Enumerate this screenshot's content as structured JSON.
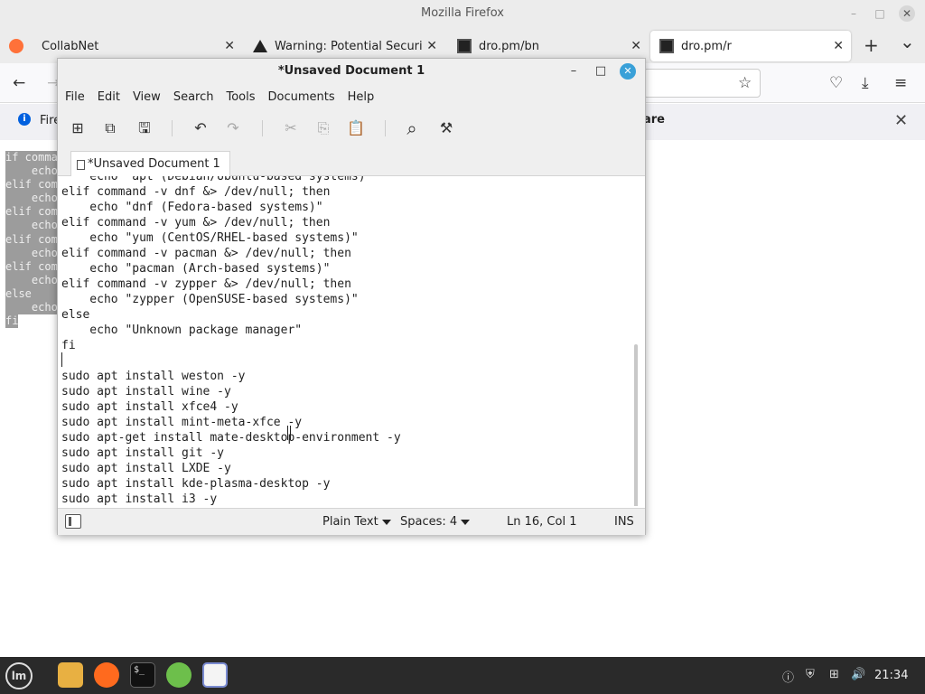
{
  "firefox": {
    "window_title": "Mozilla Firefox",
    "minimize": "–",
    "maximize": "□",
    "close": "✕",
    "tabs": [
      {
        "label": "CollabNet",
        "icon": "none"
      },
      {
        "label": "Warning: Potential Security",
        "icon": "warning-icon"
      },
      {
        "label": "dro.pm/bn",
        "icon": "dro-favicon"
      },
      {
        "label": "dro.pm/r",
        "icon": "dro-favicon",
        "active": true
      }
    ],
    "tab_close": "✕",
    "new_tab": "+",
    "tab_list": "⌄",
    "nav": {
      "back": "←",
      "forward": "→",
      "bookmark": "☆",
      "pocket": "♡",
      "downloads": "⤓",
      "menu": "≡"
    },
    "infobar": {
      "icon": "i",
      "text": "Fire",
      "share": "are",
      "close": "✕"
    },
    "page_code_lines": [
      "if comma",
      "    echo",
      "elif com",
      "    echo",
      "elif com",
      "    echo",
      "elif com",
      "    echo",
      "elif com",
      "    echo",
      "else    ",
      "    echo",
      "fi"
    ]
  },
  "editor": {
    "title": "*Unsaved Document 1",
    "minimize": "–",
    "maximize": "□",
    "close": "✕",
    "menu": [
      "File",
      "Edit",
      "View",
      "Search",
      "Tools",
      "Documents",
      "Help"
    ],
    "toolbar": {
      "new": "⊞",
      "open": "⧉",
      "save": "🖫",
      "undo": "↶",
      "redo": "↷",
      "cut": "✂",
      "copy": "⎘",
      "paste": "📋",
      "find": "⌕",
      "tools": "⚒"
    },
    "tab_label": "*Unsaved Document 1",
    "code_lines": [
      "    echo \"apt (Debian/Ubuntu-based systems)\"",
      "elif command -v dnf &> /dev/null; then",
      "    echo \"dnf (Fedora-based systems)\"",
      "elif command -v yum &> /dev/null; then",
      "    echo \"yum (CentOS/RHEL-based systems)\"",
      "elif command -v pacman &> /dev/null; then",
      "    echo \"pacman (Arch-based systems)\"",
      "elif command -v zypper &> /dev/null; then",
      "    echo \"zypper (OpenSUSE-based systems)\"",
      "else",
      "    echo \"Unknown package manager\"",
      "fi",
      "",
      "sudo apt install weston -y",
      "sudo apt install wine -y",
      "sudo apt install xfce4 -y",
      "sudo apt install mint-meta-xfce -y",
      "sudo apt-get install mate-desktop-environment -y",
      "sudo apt install git -y",
      "sudo apt install LXDE -y",
      "sudo apt install kde-plasma-desktop -y",
      "sudo apt install i3 -y"
    ],
    "status": {
      "syntax": "Plain Text",
      "spaces": "Spaces: 4",
      "position": "Ln 16, Col 1",
      "mode": "INS"
    }
  },
  "taskbar": {
    "mint_menu": "lm",
    "terminal_glyph": "$_",
    "tray": {
      "notifications": "ⓘ",
      "shield": "⛨",
      "network": "⊞",
      "volume": "🔊",
      "clock": "21:34"
    }
  },
  "colors": {
    "accent_close": "#39a0d8",
    "firefox_chrome": "#ececec",
    "taskbar": "#2a2a2a"
  }
}
